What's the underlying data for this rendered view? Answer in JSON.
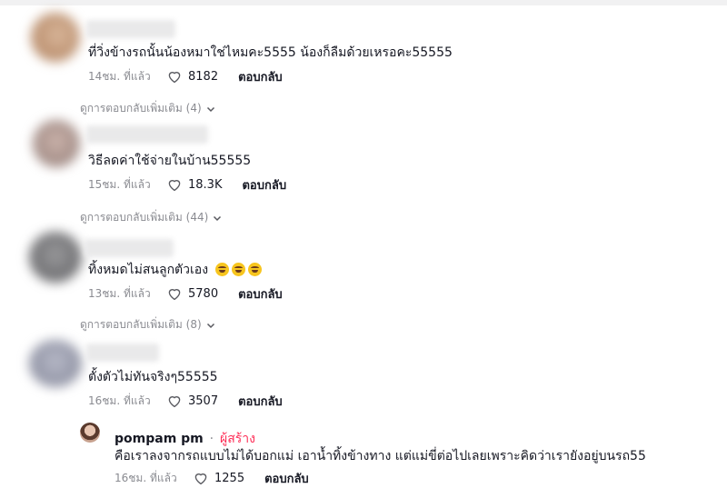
{
  "comments": [
    {
      "text": "ที่วิ่งข้างรถนั้นน้องหมาใช่ไหมคะ5555 น้องก็ลืมด้วยเหรอคะ55555",
      "time": "14ชม. ที่แล้ว",
      "likes": "8182",
      "reply_label": "ตอบกลับ",
      "more_replies": "ดูการตอบกลับเพิ่มเติม (4)"
    },
    {
      "text": "วิธีลดค่าใช้จ่ายในบ้าน55555",
      "time": "15ชม. ที่แล้ว",
      "likes": "18.3K",
      "reply_label": "ตอบกลับ",
      "more_replies": "ดูการตอบกลับเพิ่มเติม (44)"
    },
    {
      "text": "ทิ้งหมดไม่สนลูกตัวเอง",
      "time": "13ชม. ที่แล้ว",
      "likes": "5780",
      "reply_label": "ตอบกลับ",
      "more_replies": "ดูการตอบกลับเพิ่มเติม (8)"
    },
    {
      "text": "ตั้งตัวไม่ทันจริงๆ55555",
      "time": "16ชม. ที่แล้ว",
      "likes": "3507",
      "reply_label": "ตอบกลับ"
    }
  ],
  "reply": {
    "username": "pompam pm",
    "separator": "·",
    "badge": "ผู้สร้าง",
    "text": "คือเราลงจากรถแบบไม่ได้บอกแม่ เอาน้ำทิ้งข้างทาง แต่แม่ขี่ต่อไปเลยเพราะคิดว่าเรายังอยู่บนรถ55",
    "time": "16ชม. ที่แล้ว",
    "likes": "1255",
    "reply_label": "ตอบกลับ"
  },
  "icons": {
    "like": "heart-outline-icon",
    "expand": "chevron-down-icon",
    "emoji": "laughing-emoji-icon"
  },
  "colors": {
    "creator_badge": "#fe2c55",
    "muted_text": "#8a8b91"
  }
}
